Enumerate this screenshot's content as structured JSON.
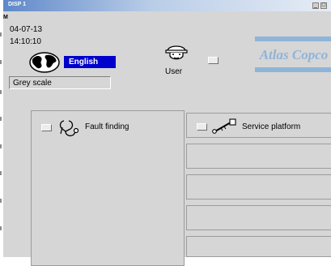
{
  "window": {
    "title": "DISP 1",
    "minimize_label": "_",
    "maximize_label": "□"
  },
  "status": {
    "mode_letter": "M",
    "date": "04-07-13",
    "time": "14:10:10"
  },
  "language": {
    "value": "English",
    "icon": "globe-icon"
  },
  "display_mode": {
    "value": "Grey scale"
  },
  "user": {
    "label": "User",
    "icon": "user-helmet-icon"
  },
  "logo": {
    "text": "Atlas Copco",
    "color": "#8fb4d8"
  },
  "menu": {
    "fault_finding": {
      "label": "Fault finding",
      "icon": "stethoscope-icon"
    },
    "service_platform": {
      "label": "Service platform",
      "icon": "wrench-icon"
    },
    "empty_slots": 4
  },
  "colors": {
    "background": "#d6d6d6",
    "language_highlight": "#0000cc"
  }
}
